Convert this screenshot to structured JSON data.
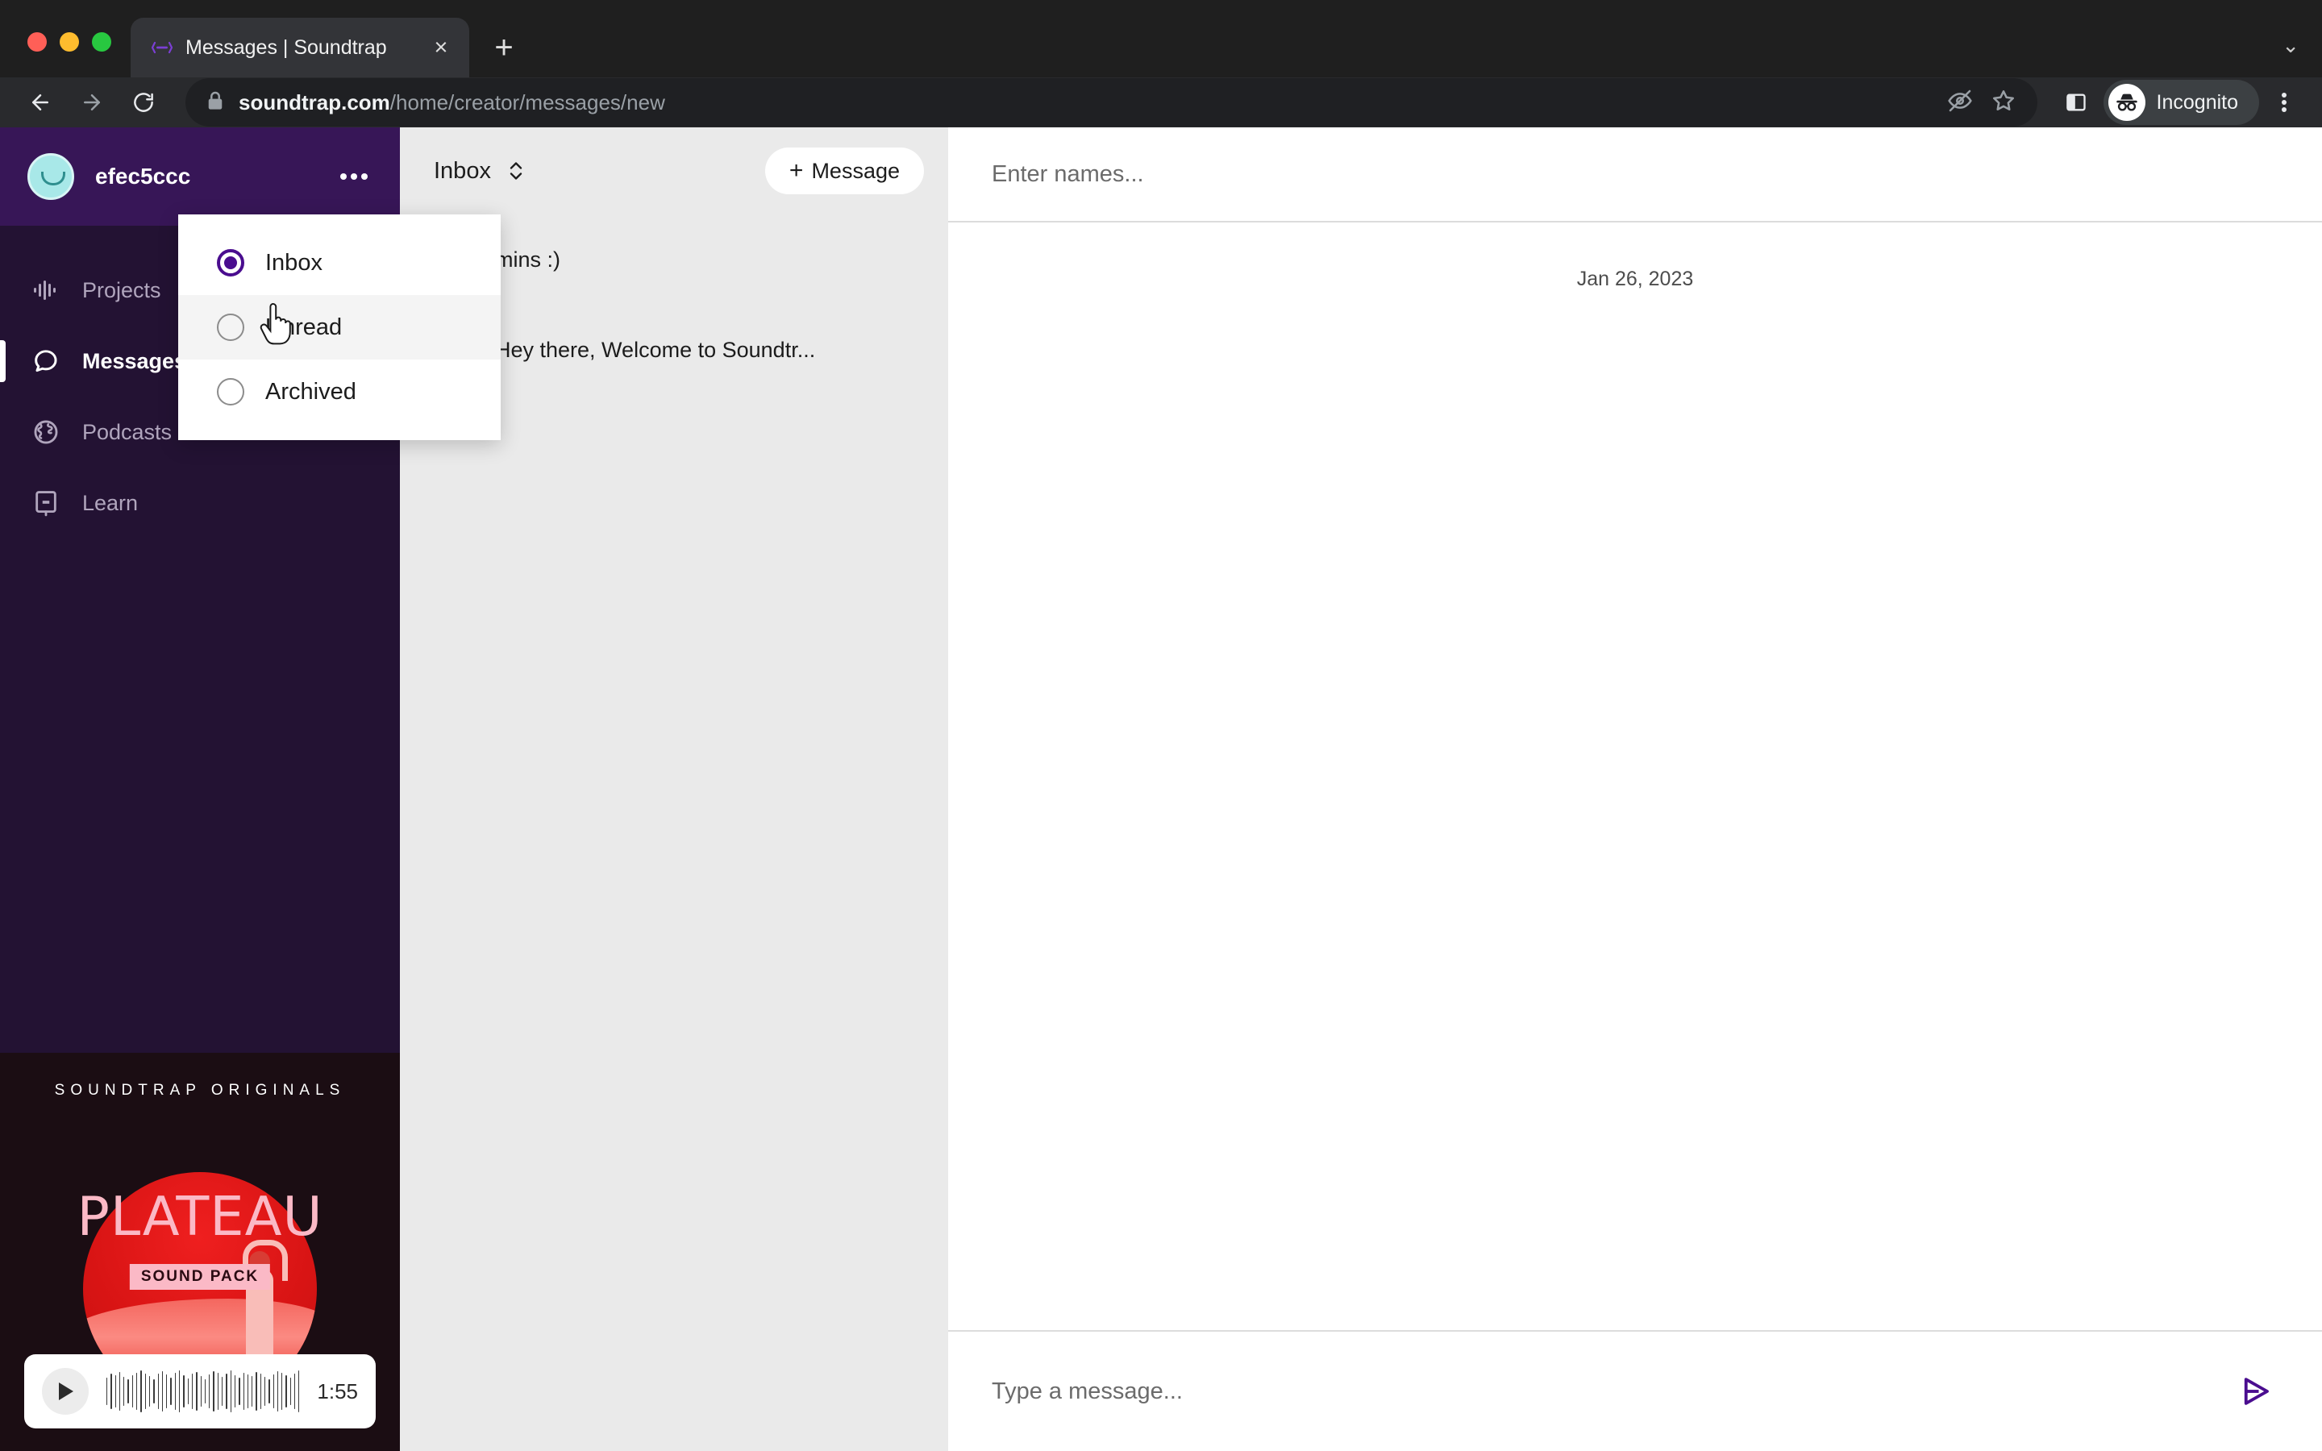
{
  "browser": {
    "tab": {
      "title": "Messages | Soundtrap",
      "favicon": "soundtrap-logo-icon",
      "close": "×"
    },
    "new_tab_label": "+",
    "tab_list_chevron": "⌄",
    "url": {
      "domain": "soundtrap.com",
      "path": "/home/creator/messages/new",
      "lock": "lock-icon"
    },
    "profile": {
      "label": "Incognito",
      "icon": "incognito-icon"
    },
    "actions": {
      "back": "back-arrow-icon",
      "forward": "forward-arrow-icon",
      "reload": "reload-icon",
      "tracking_protection": "eye-slash-icon",
      "bookmark": "star-icon",
      "side_panel": "side-panel-icon",
      "menu": "kebab-menu-icon"
    }
  },
  "sidebar": {
    "username": "efec5ccc",
    "kebab": "kebab-menu-icon",
    "items": [
      {
        "label": "Projects",
        "icon": "waveform-icon",
        "active": false
      },
      {
        "label": "Messages",
        "icon": "chat-bubble-icon",
        "active": true
      },
      {
        "label": "Podcasts",
        "icon": "globe-icon",
        "active": false
      },
      {
        "label": "Learn",
        "icon": "book-icon",
        "active": false
      }
    ],
    "promo": {
      "kicker": "SOUNDTRAP ORIGINALS",
      "title": "PLATEAU",
      "badge": "SOUND PACK",
      "player": {
        "play_icon": "play-icon",
        "time": "1:55"
      }
    }
  },
  "list_panel": {
    "filter": {
      "selected": "Inbox",
      "chevron_icon": "chevron-updown-icon"
    },
    "new_message_button": {
      "plus": "+",
      "label": "Message"
    },
    "dropdown": {
      "open": true,
      "options": [
        {
          "label": "Inbox",
          "selected": true,
          "highlighted": false
        },
        {
          "label": "Unread",
          "selected": false,
          "highlighted": true
        },
        {
          "label": "Archived",
          "selected": false,
          "highlighted": false
        }
      ]
    },
    "conversations": [
      {
        "preview": "mins :)"
      },
      {
        "preview": "Hey there, Welcome to Soundtr..."
      }
    ]
  },
  "conversation_panel": {
    "recipients_placeholder": "Enter names...",
    "date_separator": "Jan 26, 2023",
    "composer_placeholder": "Type a message...",
    "send_icon": "send-icon"
  },
  "colors": {
    "brand_purple": "#4a0d8f",
    "sidebar_header": "#371657",
    "sidebar_body": "#231233",
    "list_panel_bg": "#eaeaea",
    "promo_red": "#d81414",
    "promo_pink": "#fbb9c6"
  }
}
